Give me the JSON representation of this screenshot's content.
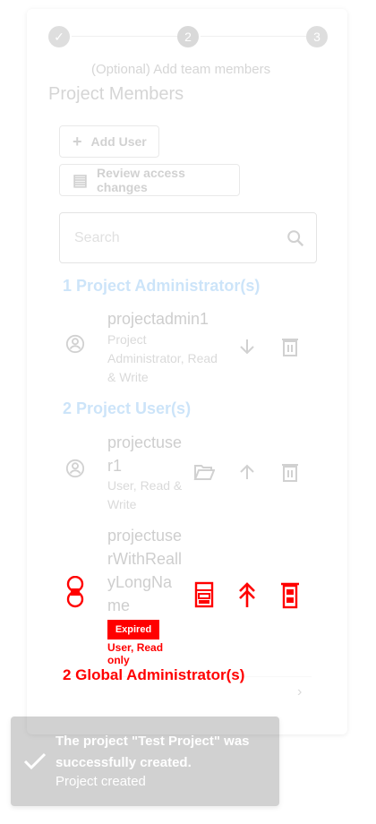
{
  "stepper": {
    "steps": [
      {
        "icon": "check-icon"
      },
      {
        "number": "2"
      },
      {
        "number": "3"
      }
    ],
    "active_label": "(Optional) Add team members"
  },
  "section_title": "Project Members",
  "buttons": {
    "add_user": "Add User",
    "review_access": "Review access changes"
  },
  "search": {
    "placeholder": "Search"
  },
  "groups": {
    "admins_title": "1 Project Administrator(s)",
    "users_title": "2 Project User(s)",
    "global_title": "2 Global Administrator(s)"
  },
  "members": [
    {
      "name": "projectadmin1",
      "role": "Project Administrator, Read & Write"
    },
    {
      "name": "projectuser1",
      "role": "User, Read & Write"
    },
    {
      "name": "projectuserWithReallyLongName",
      "role": "User, Read only",
      "badge": "Expired"
    }
  ],
  "snackbar": {
    "message": "The project \"Test Project\" was successfully created.",
    "submessage": "Project created"
  },
  "colors": {
    "accent": "#1e88e5",
    "highlight": "#ff0000",
    "snackbar": "#323232"
  }
}
